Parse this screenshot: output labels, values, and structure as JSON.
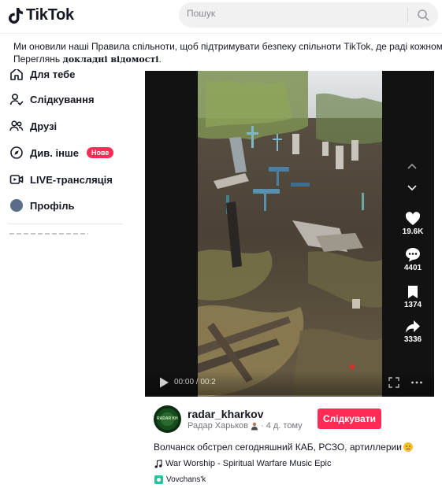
{
  "brand": {
    "name": "TikTok"
  },
  "search": {
    "placeholder": "Пошук"
  },
  "notice": {
    "text": "Ми оновили наші Правила спільноти, щоб підтримувати безпеку спільноти TikTok, де раді кожному.",
    "text2": "Переглянь ",
    "link": "докладні відомості",
    "end": "."
  },
  "sidebar": {
    "items": [
      {
        "label": "Для тебе",
        "icon": "home-icon"
      },
      {
        "label": "Слідкування",
        "icon": "following-icon"
      },
      {
        "label": "Друзі",
        "icon": "friends-icon"
      },
      {
        "label": "Див. інше",
        "icon": "explore-icon",
        "badge": "Нове"
      },
      {
        "label": "LIVE-трансляція",
        "icon": "live-icon"
      },
      {
        "label": "Профіль",
        "icon": "profile-icon"
      }
    ]
  },
  "video": {
    "time": "00:00 / 00:2",
    "actions": {
      "likes": "19.6K",
      "comments": "4401",
      "saves": "1374",
      "shares": "3336"
    }
  },
  "post": {
    "username": "radar_kharkov",
    "display_name": "Радар Харьков",
    "age": "· 4 д. тому",
    "follow_label": "Слідкувати",
    "description": "Волчанск обстрел сегодняшний КАБ, РСЗО, артиллерии",
    "music": "War Worship - Spiritual Warfare Music Epic",
    "location": "Vovchans'k",
    "avatar_text": "RADAR KH"
  },
  "colors": {
    "accent": "#fe2c55",
    "text": "#161823",
    "muted": "#75777e",
    "video_bg": "#121212"
  }
}
